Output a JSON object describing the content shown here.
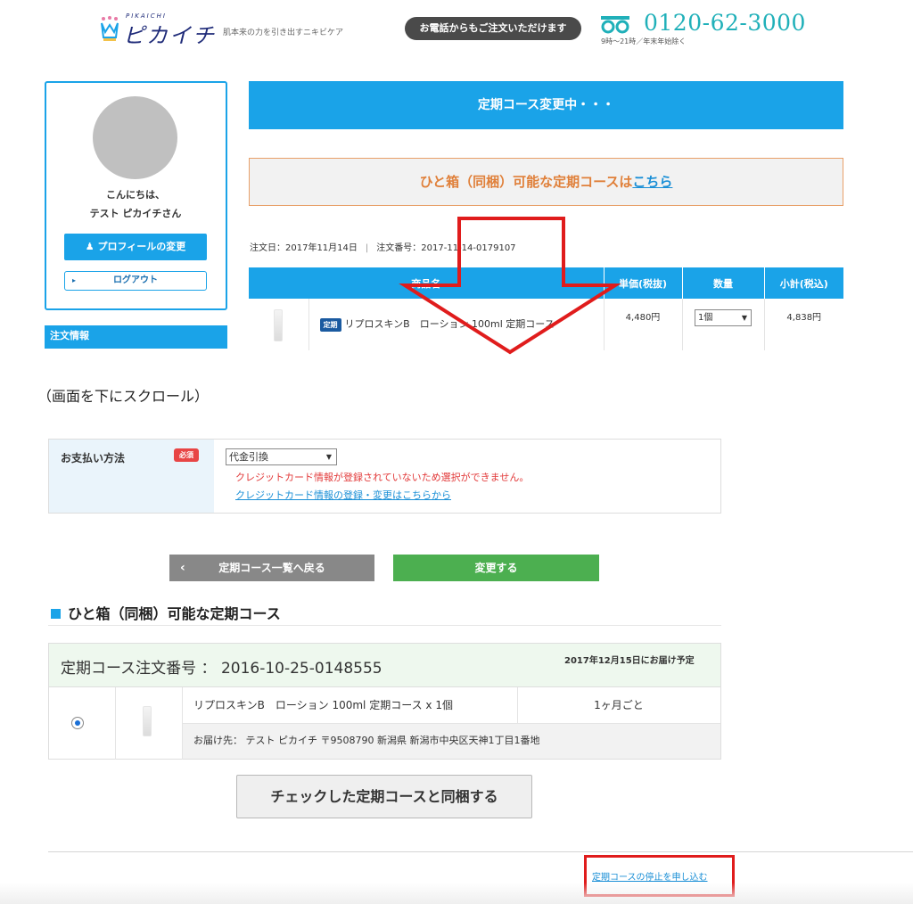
{
  "header": {
    "brand_sub": "PIKAICHI",
    "brand_name": "ピカイチ",
    "tagline": "肌本来の力を引き出すニキビケア",
    "phone_cta": "お電話からもご注文いただけます",
    "phone_number": "0120-62-3000",
    "phone_hours": "9時〜21時／年末年始除く"
  },
  "sidebar": {
    "greeting_line1": "こんにちは、",
    "greeting_line2": "テスト ピカイチさん",
    "profile_button": "プロフィールの変更",
    "logout_button": "ログアウト",
    "section_label": "注文情報"
  },
  "main": {
    "banner": "定期コース変更中・・・",
    "bundle_notice_text": "ひと箱（同梱）可能な定期コースは",
    "bundle_notice_link": "こちら",
    "order_date": "注文日：2017年11月14日",
    "order_number": "注文番号：2017-11-14-0179107",
    "table": {
      "headers": [
        "商品名",
        "単価(税抜)",
        "数量",
        "小計(税込)"
      ],
      "rows": [
        {
          "tag": "定期",
          "name": "リプロスキンB　ローション 100ml 定期コース",
          "unit_price": "4,480円",
          "quantity": "1個",
          "subtotal": "4,838円"
        }
      ]
    }
  },
  "scroll_note": "（画面を下にスクロール）",
  "payment": {
    "label": "お支払い方法",
    "required_badge": "必須",
    "selected": "代金引換",
    "error": "クレジットカード情報が登録されていないため選択ができません。",
    "card_link": "クレジットカード情報の登録・変更はこちらから"
  },
  "actions": {
    "back": "定期コース一覧へ戻る",
    "change": "変更する"
  },
  "bundle_section": {
    "title": "ひと箱（同梱）可能な定期コース",
    "course_number": "定期コース注文番号 ： 2016-10-25-0148555",
    "delivery_date": "2017年12月15日にお届け予定",
    "product": "リプロスキンB　ローション 100ml 定期コース x 1個",
    "cycle": "1ヶ月ごと",
    "address": "お届け先： テスト ピカイチ 〒9508790 新潟県 新潟市中央区天神1丁目1番地",
    "bundle_button": "チェックした定期コースと同梱する"
  },
  "footer": {
    "stop_link": "定期コースの停止を申し込む"
  },
  "colors": {
    "primary_blue": "#1aa3e8",
    "accent_orange": "#e0803a",
    "green": "#4caf50",
    "annotation_red": "#e01c1c"
  }
}
